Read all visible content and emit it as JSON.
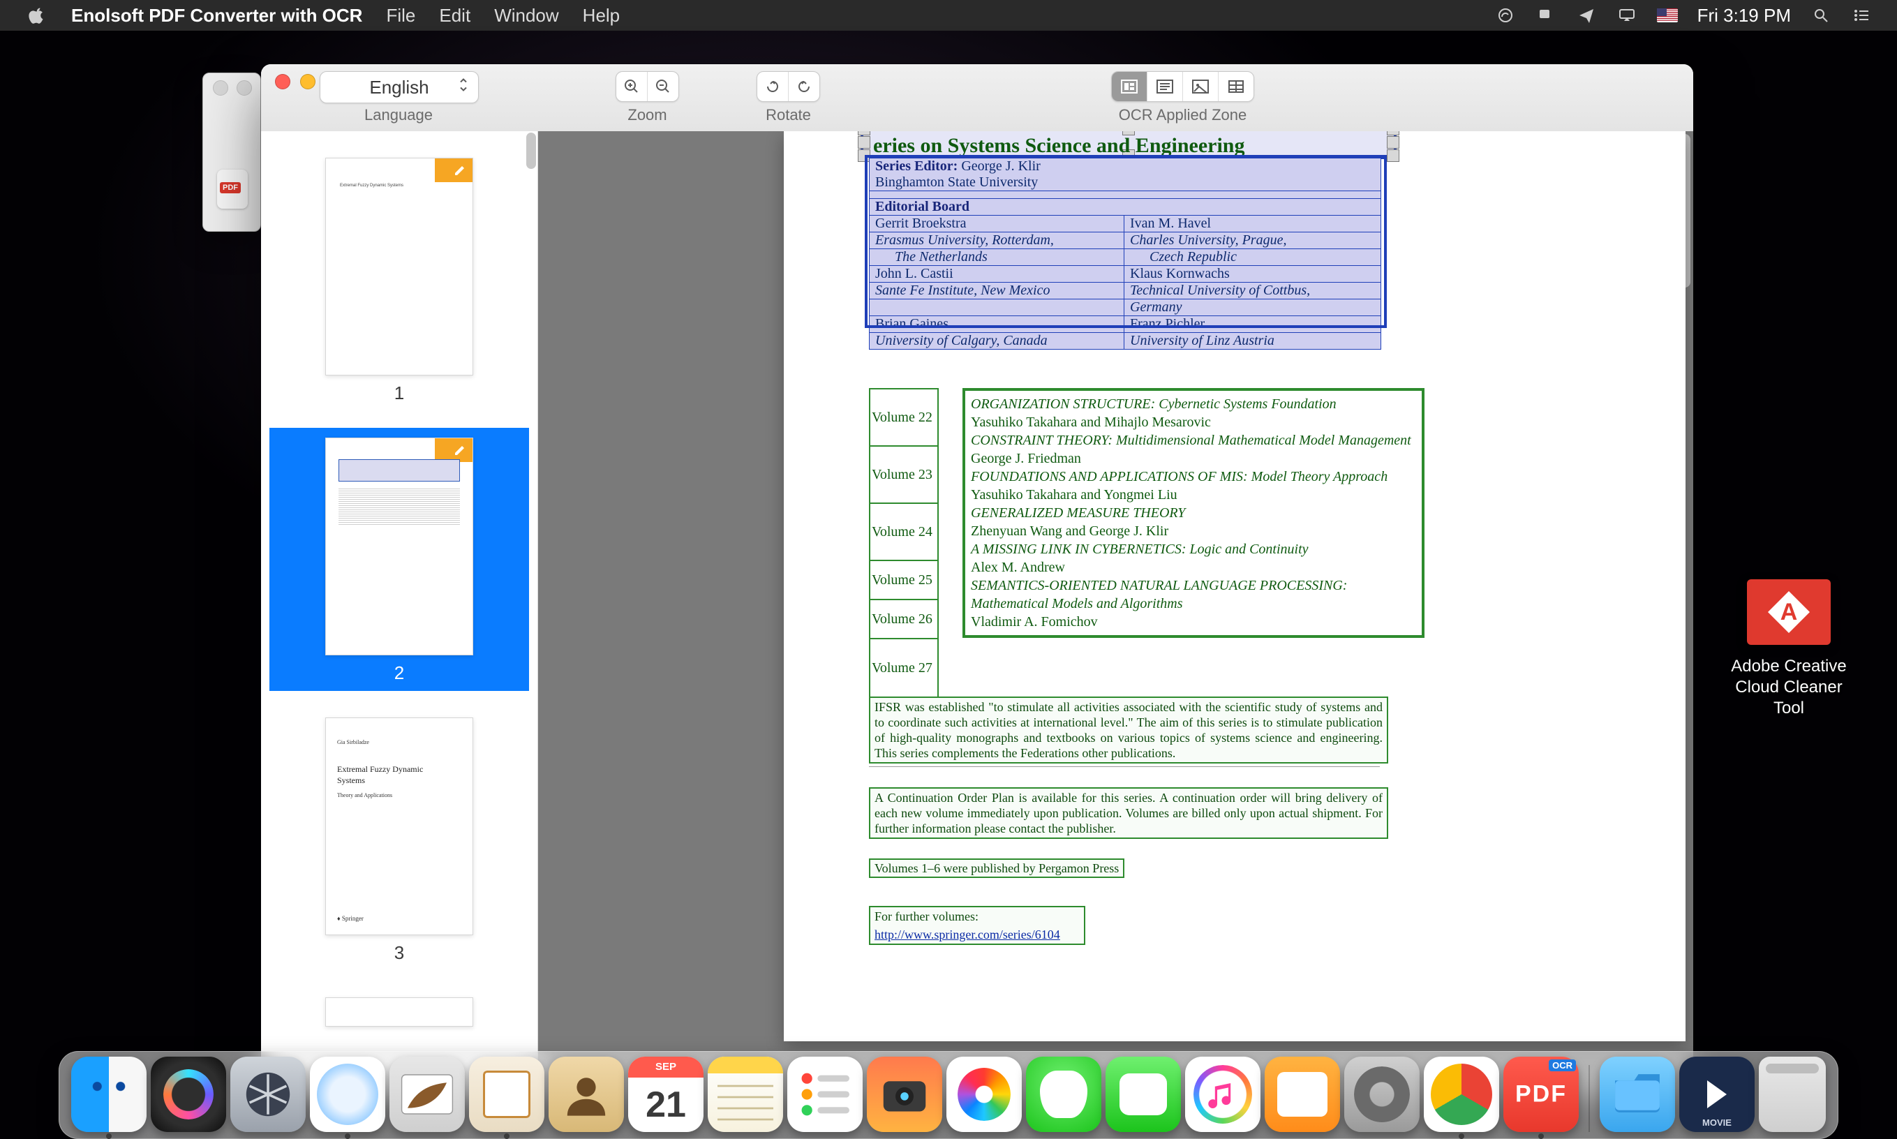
{
  "menubar": {
    "app_name": "Enolsoft PDF Converter with OCR",
    "items": [
      "File",
      "Edit",
      "Window",
      "Help"
    ],
    "clock": "Fri 3:19 PM"
  },
  "desktop": {
    "cc_cleaner_label_l1": "Adobe Creative",
    "cc_cleaner_label_l2": "Cloud Cleaner Tool"
  },
  "toolbar": {
    "language_value": "English",
    "language_label": "Language",
    "zoom_label": "Zoom",
    "rotate_label": "Rotate",
    "ocr_label": "OCR Applied Zone"
  },
  "thumbnails": {
    "page1": {
      "num": "1",
      "title": "Extremal Fuzzy Dynamic Systems"
    },
    "page2": {
      "num": "2"
    },
    "page3": {
      "num": "3",
      "author": "Gia Sirbiladze",
      "line1": "Extremal Fuzzy Dynamic",
      "line2": "Systems",
      "sub": "Theory and Applications",
      "pub": "♦ Springer"
    }
  },
  "document": {
    "series_title": "eries on Systems Science and Engineering",
    "editor_label": "Series Editor:",
    "editor_name": " George J. Klir",
    "editor_affil": "Binghamton State University",
    "board_header": "Editorial Board",
    "board_left": [
      "Gerrit Broekstra",
      {
        "text": "Erasmus University, Rotterdam,",
        "em": true
      },
      {
        "text": "The Netherlands",
        "em": true,
        "indent": true
      },
      "John L. Castii",
      {
        "text": "Sante Fe Institute, New Mexico",
        "em": true
      },
      "",
      "Brian Gaines",
      {
        "text": "University of Calgary, Canada",
        "em": true
      }
    ],
    "board_right": [
      "Ivan M. Havel",
      {
        "text": "Charles University, Prague,",
        "em": true
      },
      {
        "text": "Czech Republic",
        "em": true,
        "indent": true
      },
      "Klaus Kornwachs",
      {
        "text": "Technical University of Cottbus,",
        "em": true
      },
      {
        "text": "Germany",
        "em": true
      },
      "Franz Pichler",
      {
        "text": "University of Linz Austria",
        "em": true
      }
    ],
    "volumes": [
      {
        "no": "Volume 22",
        "title": "ORGANIZATION STRUCTURE: Cybernetic Systems Foundation",
        "author": "Yasuhiko Takahara and Mihajlo Mesarovic"
      },
      {
        "no": "Volume 23",
        "title": "CONSTRAINT THEORY: Multidimensional Mathematical Model Management",
        "author": "George J. Friedman"
      },
      {
        "no": "Volume 24",
        "title": "FOUNDATIONS AND APPLICATIONS OF MIS: Model Theory Approach",
        "author": "Yasuhiko Takahara and Yongmei Liu"
      },
      {
        "no": "Volume 25",
        "title": "GENERALIZED MEASURE THEORY",
        "author": "Zhenyuan Wang and George J. Klir"
      },
      {
        "no": "Volume 26",
        "title": "A MISSING LINK IN CYBERNETICS: Logic and Continuity",
        "author": "Alex M. Andrew"
      },
      {
        "no": "Volume 27",
        "title": "SEMANTICS-ORIENTED NATURAL LANGUAGE PROCESSING: Mathematical Models and Algorithms",
        "author": "Vladimir A. Fomichov"
      }
    ],
    "para1": "IFSR was established \"to stimulate all activities associated with the scientific study of systems and to coordinate such activities at international level.\" The aim of this series is to stimulate publication of high-quality monographs and textbooks on various topics of systems science and engineering. This series complements the Federations other publications.",
    "para2": "A Continuation Order Plan is available for this series. A continuation order will bring delivery of each new volume immediately upon publication. Volumes are billed only upon actual shipment. For further information please contact the publisher.",
    "note_pergamon": "Volumes 1–6 were published by Pergamon Press",
    "further_label": "For further volumes:",
    "further_url": "http://www.springer.com/series/6104"
  },
  "dock": {
    "calendar_month": "SEP",
    "calendar_day": "21",
    "pdf_label": "PDF",
    "movie_label": "MOVIE"
  }
}
